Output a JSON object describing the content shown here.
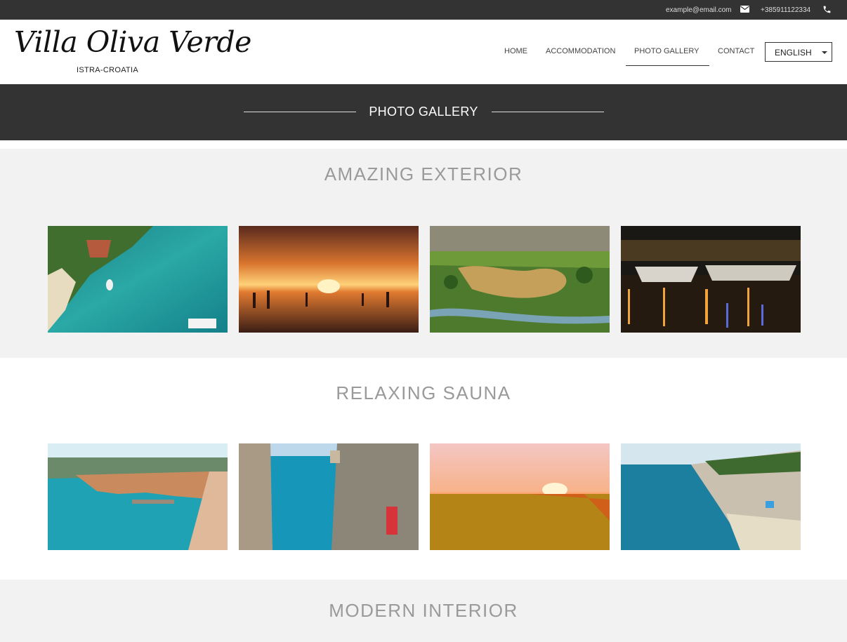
{
  "topbar": {
    "email": "example@email.com",
    "phone": "+385911122334",
    "email_icon": "envelope-icon",
    "phone_icon": "phone-icon"
  },
  "header": {
    "logo_title": "Villa Oliva Verde",
    "logo_subtitle": "ISTRA-CROATIA",
    "nav": {
      "home": "HOME",
      "accommodation": "ACCOMMODATION",
      "gallery": "PHOTO GALLERY",
      "contact": "CONTACT"
    },
    "active_nav": "PHOTO GALLERY",
    "language": "ENGLISH"
  },
  "separator": {
    "title": "PHOTO GALLERY"
  },
  "galleries": [
    {
      "title": "AMAZING EXTERIOR",
      "images": [
        "aerial-bay-photo",
        "sunset-reflection-photo",
        "aerial-river-photo",
        "night-harbour-photo"
      ]
    },
    {
      "title": "RELAXING SAUNA",
      "images": [
        "old-town-coast-photo",
        "alley-sea-view-photo",
        "sunflower-field-sunset-photo",
        "rocky-beach-photo"
      ]
    },
    {
      "title": "MODERN INTERIOR",
      "images": []
    }
  ],
  "colors": {
    "topbar_bg": "#333333",
    "separator_bg": "#333333",
    "gallery_grey": "#f2f2f2",
    "section_title": "#9a9a9a"
  }
}
